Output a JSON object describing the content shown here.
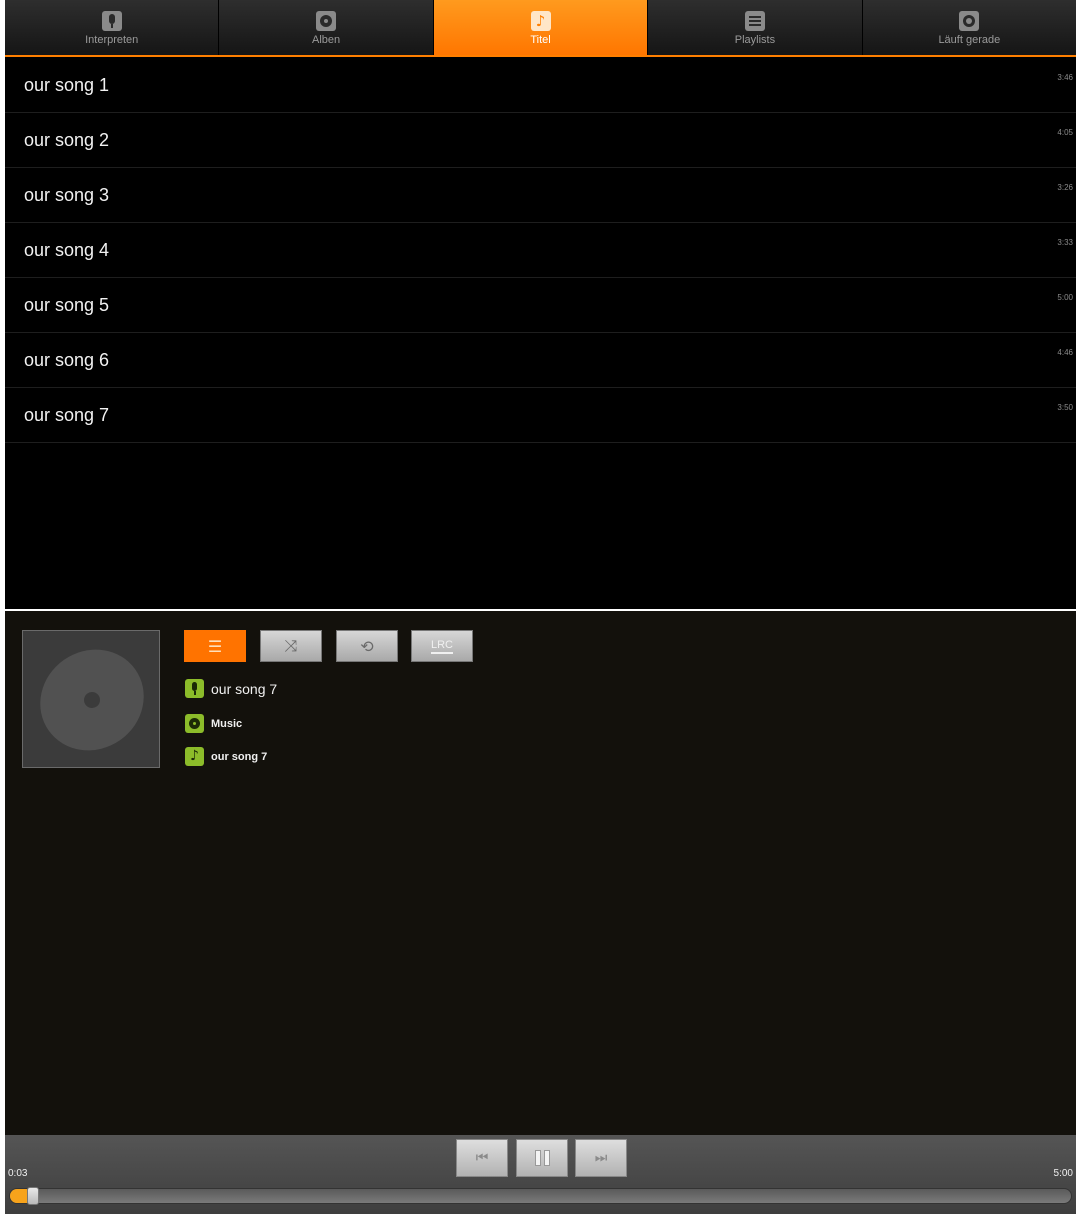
{
  "tabs": [
    {
      "label": "Interpreten",
      "icon": "microphone-icon"
    },
    {
      "label": "Alben",
      "icon": "album-disc-icon"
    },
    {
      "label": "Titel",
      "icon": "music-note-icon",
      "active": true
    },
    {
      "label": "Playlists",
      "icon": "playlist-icon"
    },
    {
      "label": "Läuft gerade",
      "icon": "now-playing-icon"
    }
  ],
  "songs": [
    {
      "title": "our song 1",
      "duration": "3:46"
    },
    {
      "title": "our song 2",
      "duration": "4:05"
    },
    {
      "title": "our song 3",
      "duration": "3:26"
    },
    {
      "title": "our song 4",
      "duration": "3:33"
    },
    {
      "title": "our song 5",
      "duration": "5:00"
    },
    {
      "title": "our song 6",
      "duration": "4:46"
    },
    {
      "title": "our song 7",
      "duration": "3:50"
    }
  ],
  "player": {
    "controls": {
      "queue_icon": "queue-list-icon",
      "shuffle_icon": "shuffle-icon",
      "repeat_icon": "repeat-icon",
      "lrc_label": "LRC"
    },
    "artist": "our song 7",
    "album": "Music",
    "title": "our song 7"
  },
  "transport": {
    "elapsed": "0:03",
    "total": "5:00",
    "progress": 0.01
  },
  "colors": {
    "accent": "#ff7f00",
    "info_icon": "#8cbc2a",
    "background": "#000000",
    "panel": "#13110c"
  }
}
